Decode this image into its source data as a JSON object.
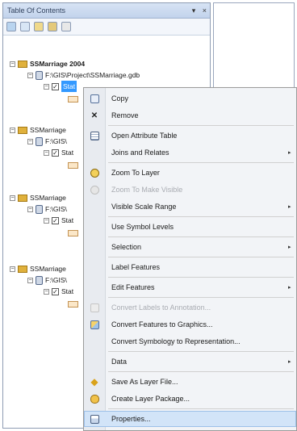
{
  "toc": {
    "title": "Table Of Contents",
    "title_buttons": [
      "▾",
      "×"
    ],
    "frames": [
      {
        "name": "SSMarriage 2004",
        "path": "F:\\GIS\\Project\\SSMarriage.gdb",
        "layer": "Stat"
      },
      {
        "name": "SSMarriage",
        "path": "F:\\GIS\\",
        "layer": "Stat"
      },
      {
        "name": "SSMarriage",
        "path": "F:\\GIS\\",
        "layer": "Stat"
      },
      {
        "name": "SSMarriage",
        "path": "F:\\GIS\\",
        "layer": "Stat"
      }
    ]
  },
  "context_menu": {
    "items": [
      {
        "label": "Copy",
        "icon": "copy-icon"
      },
      {
        "label": "Remove",
        "icon": "remove-icon"
      },
      {
        "label": "Open Attribute Table",
        "icon": "table-icon"
      },
      {
        "label": "Joins and Relates",
        "icon": "",
        "submenu": "▸"
      },
      {
        "label": "Zoom To Layer",
        "icon": "zoom-to-layer-icon"
      },
      {
        "label": "Zoom To Make Visible",
        "icon": "zoom-to-visible-icon"
      },
      {
        "label": "Visible Scale Range",
        "icon": "",
        "submenu": "▸"
      },
      {
        "label": "Use Symbol Levels",
        "icon": ""
      },
      {
        "label": "Selection",
        "icon": "",
        "submenu": "▸"
      },
      {
        "label": "Label Features",
        "icon": ""
      },
      {
        "label": "Edit Features",
        "icon": "",
        "submenu": "▸"
      },
      {
        "label": "Convert Labels to Annotation...",
        "icon": "convert-labels-icon"
      },
      {
        "label": "Convert Features to Graphics...",
        "icon": "convert-features-icon"
      },
      {
        "label": "Convert Symbology to Representation...",
        "icon": ""
      },
      {
        "label": "Data",
        "icon": "",
        "submenu": "▸"
      },
      {
        "label": "Save As Layer File...",
        "icon": "save-layer-icon"
      },
      {
        "label": "Create Layer Package...",
        "icon": "layer-package-icon"
      },
      {
        "label": "Properties...",
        "icon": "properties-icon"
      }
    ]
  },
  "colors": {
    "selection": "#3399ff",
    "menu_hover": "#d2e4f8",
    "folder": "#e0b13c"
  }
}
